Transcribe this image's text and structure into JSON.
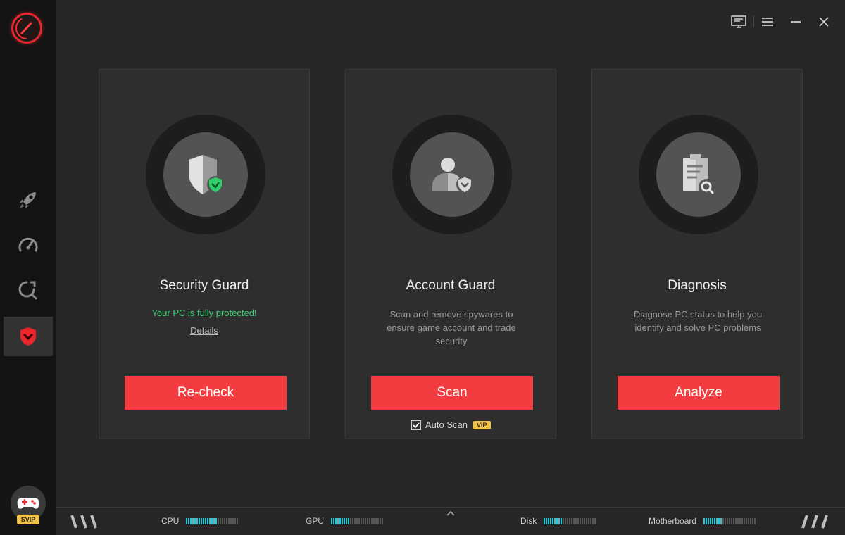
{
  "sidebar": {
    "items": [
      {
        "name": "boost",
        "icon": "rocket-icon"
      },
      {
        "name": "speedometer",
        "icon": "speedometer-icon"
      },
      {
        "name": "scan",
        "icon": "magnifier-refresh-icon"
      },
      {
        "name": "security",
        "icon": "shield-icon",
        "active": true
      }
    ],
    "svip_label": "SVIP"
  },
  "topbar": {
    "icons": [
      "monitor-icon",
      "menu-icon",
      "minimize-icon",
      "close-icon"
    ]
  },
  "cards": [
    {
      "title": "Security Guard",
      "status": "Your PC is fully protected!",
      "link": "Details",
      "button": "Re-check",
      "icon": "shield-check-icon"
    },
    {
      "title": "Account Guard",
      "description": "Scan and remove spywares to ensure game account and trade security",
      "button": "Scan",
      "icon": "user-shield-icon",
      "autoscan_label": "Auto Scan",
      "autoscan_checked": true,
      "vip_tag": "VIP"
    },
    {
      "title": "Diagnosis",
      "description": "Diagnose PC status to help you identify and solve PC problems",
      "button": "Analyze",
      "icon": "clipboard-search-icon"
    }
  ],
  "footer": {
    "monitors": [
      {
        "label": "CPU",
        "level": 0.6
      },
      {
        "label": "GPU",
        "level": 0.35
      },
      {
        "label": "Disk",
        "level": 0.35
      },
      {
        "label": "Motherboard",
        "level": 0.35
      }
    ]
  },
  "colors": {
    "accent": "#f23c3f",
    "success": "#3fd27a",
    "meter": "#2cc7d6",
    "vip": "#f0c34a"
  }
}
